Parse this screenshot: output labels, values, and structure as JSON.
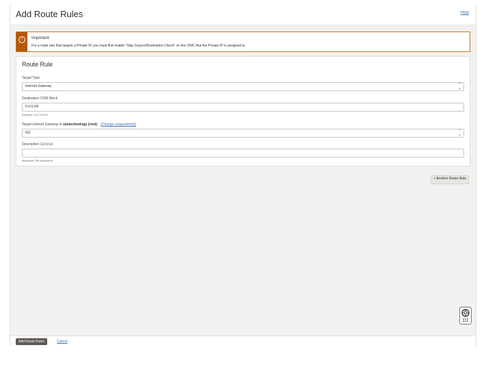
{
  "header": {
    "title": "Add Route Rules",
    "help_label": "Help"
  },
  "alert": {
    "icon": "info-icon",
    "title": "Important:",
    "body": "For a route rule that targets a Private IP, you must first enable \"Skip Source/Destination Check\" on the VNIC that the Private IP is assigned to."
  },
  "route_rule": {
    "title": "Route Rule",
    "target_type": {
      "label": "Target Type",
      "value": "Internet Gateway"
    },
    "destination_cidr": {
      "label": "Destination CIDR Block",
      "value": "0.0.0.0/0",
      "hint": "Example: 10.0.0.0/24"
    },
    "target_gateway": {
      "label_prefix": "Target Internet Gateway in",
      "compartment": "sbstechnology (root)",
      "change_link": "(Change compartment)",
      "value": "IG1"
    },
    "description": {
      "label": "Description",
      "optional": "Optional",
      "value": "",
      "hint": "Maximum 255 characters"
    }
  },
  "add_another_label": "+ Another Route Rule",
  "footer": {
    "primary_label": "Add Route Rules",
    "cancel_label": "Cancel"
  },
  "colors": {
    "alert_accent": "#b4580e",
    "link": "#3d6db5",
    "primary_button": "#5d5a56"
  }
}
